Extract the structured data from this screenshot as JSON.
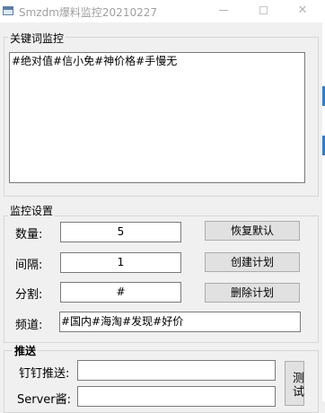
{
  "window": {
    "title": "Smzdm爆料监控20210227",
    "minimize_label": "minimize",
    "maximize_label": "maximize",
    "close_label": "✕"
  },
  "keywords": {
    "group_label": "关键词监控",
    "value": "#绝对值#信小免#神价格#手慢无"
  },
  "settings": {
    "group_label": "监控设置",
    "count_label": "数量:",
    "count_value": "5",
    "interval_label": "间隔:",
    "interval_value": "1",
    "split_label": "分割:",
    "split_value": "#",
    "channel_label": "频道:",
    "channel_value": "#国内#海淘#发现#好价",
    "restore_button": "恢复默认",
    "create_button": "创建计划",
    "delete_button": "删除计划"
  },
  "push": {
    "group_label": "推送",
    "dingtalk_label": "钉钉推送:",
    "dingtalk_value": "",
    "server_label": "Server酱:",
    "server_value": "",
    "test_button": "测试"
  },
  "colors": {
    "background": "#f0f0f0",
    "button": "#e1e1e1",
    "accent_edge": "#2b7fd4"
  }
}
